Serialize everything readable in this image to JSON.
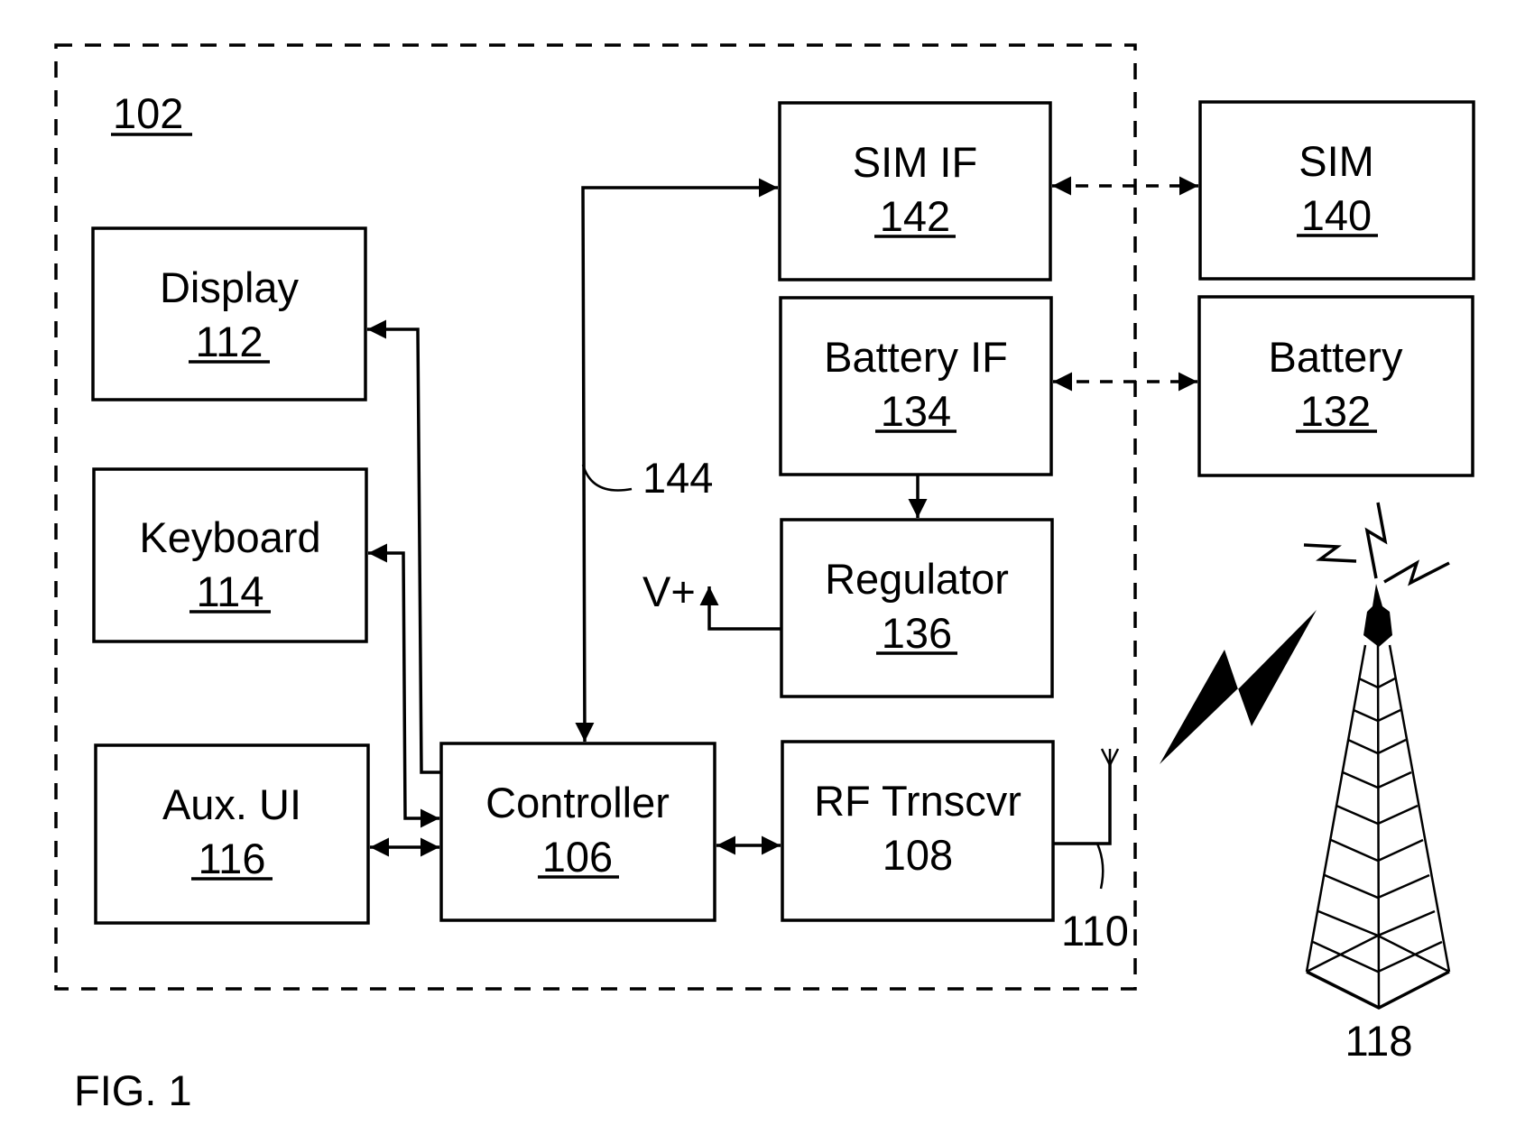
{
  "figure_label": "FIG. 1",
  "device": {
    "ref": "102"
  },
  "blocks": {
    "display": {
      "name": "Display",
      "ref": "112"
    },
    "keyboard": {
      "name": "Keyboard",
      "ref": "114"
    },
    "aux_ui": {
      "name": "Aux. UI",
      "ref": "116"
    },
    "controller": {
      "name": "Controller",
      "ref": "106"
    },
    "rf": {
      "name": "RF Trnscvr",
      "ref": "108"
    },
    "sim_if": {
      "name": "SIM IF",
      "ref": "142"
    },
    "battery_if": {
      "name": "Battery IF",
      "ref": "134"
    },
    "regulator": {
      "name": "Regulator",
      "ref": "136"
    },
    "sim": {
      "name": "SIM",
      "ref": "140"
    },
    "battery": {
      "name": "Battery",
      "ref": "132"
    }
  },
  "labels": {
    "bus": "144",
    "vplus": "V+",
    "antenna": "110",
    "tower": "118"
  },
  "colors": {
    "ink": "#000000",
    "paper": "#ffffff"
  }
}
